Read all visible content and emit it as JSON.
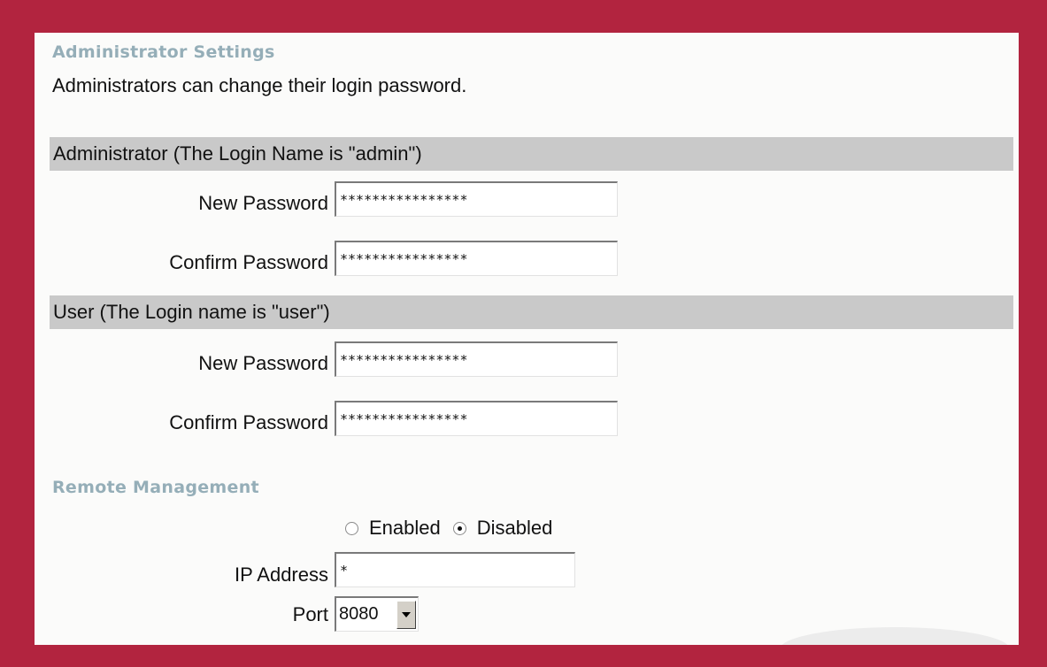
{
  "admin_settings": {
    "title": "Administrator Settings",
    "description": "Administrators can change their login password."
  },
  "administrator": {
    "header": "Administrator (The Login Name is \"admin\")",
    "new_password_label": "New Password",
    "new_password_value": "****************",
    "confirm_password_label": "Confirm Password",
    "confirm_password_value": "****************"
  },
  "user": {
    "header": "User (The Login name is \"user\")",
    "new_password_label": "New Password",
    "new_password_value": "****************",
    "confirm_password_label": "Confirm Password",
    "confirm_password_value": "****************"
  },
  "remote_management": {
    "title": "Remote Management",
    "enabled_label": "Enabled",
    "disabled_label": "Disabled",
    "selected": "Disabled",
    "ip_address_label": "IP Address",
    "ip_address_value": "*",
    "port_label": "Port",
    "port_value": "8080"
  },
  "colors": {
    "frame": "#b2243f",
    "section_title": "#95aeb8",
    "group_bar": "#c9c9c9"
  }
}
